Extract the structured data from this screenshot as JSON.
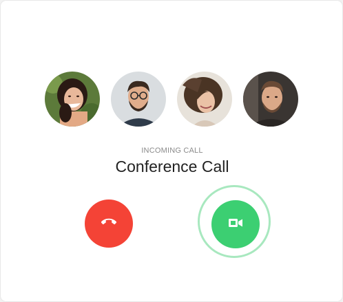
{
  "call": {
    "status_label": "INCOMING CALL",
    "title": "Conference Call"
  },
  "participants": [
    {
      "avatar": "woman-with-dark-hair-avatar"
    },
    {
      "avatar": "man-with-glasses-avatar"
    },
    {
      "avatar": "woman-with-windblown-hair-avatar"
    },
    {
      "avatar": "bearded-man-avatar"
    }
  ],
  "actions": {
    "decline_icon": "hang-up-phone-icon",
    "accept_icon": "video-camera-icon"
  },
  "colors": {
    "decline": "#f44336",
    "accept": "#3ccf72",
    "accept_ring": "#a8e8bf"
  }
}
